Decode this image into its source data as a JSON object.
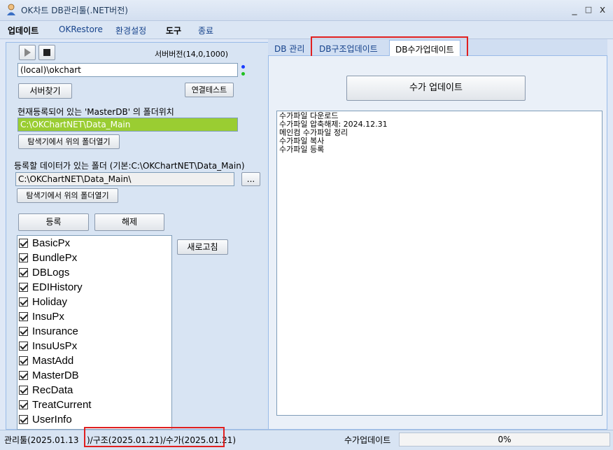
{
  "window": {
    "title": "OK차트 DB관리툴(.NET버전)",
    "minimize": "_",
    "maximize": "□",
    "close": "x"
  },
  "menu": [
    "업데이트",
    "OKRestore",
    "환경설정",
    "도구",
    "종료"
  ],
  "left": {
    "server_version": "서버버전(14,0,1000)",
    "server_value": "(local)\\okchart",
    "find_server_button": "서버찾기",
    "connect_test_button": "연결테스트",
    "masterdb_folder_label": "현재등록되어 있는 'MasterDB' 의 폴더위치",
    "masterdb_folder_value": "C:\\OKChartNET\\Data_Main",
    "open_folder_button_1": "탐색기에서 위의 폴더열기",
    "data_folder_label": "등록할 데이터가 있는 폴더 (기본:C:\\OKChartNET\\Data_Main)",
    "data_folder_value": "C:\\OKChartNET\\Data_Main\\",
    "browse_button": "...",
    "open_folder_button_2": "탐색기에서 위의 폴더열기",
    "register_button": "등록",
    "unregister_button": "해제",
    "refresh_button": "새로고침",
    "databases": [
      "BasicPx",
      "BundlePx",
      "DBLogs",
      "EDIHistory",
      "Holiday",
      "InsuPx",
      "Insurance",
      "InsuUsPx",
      "MastAdd",
      "MasterDB",
      "RecData",
      "TreatCurrent",
      "UserInfo"
    ]
  },
  "tabs": [
    "DB 관리",
    "DB구조업데이트",
    "DB수가업데이트"
  ],
  "right": {
    "update_button": "수가 업데이트",
    "log": [
      "수가파일 다운로드",
      "수가파일 압축해제: 2024.12.31",
      "메인컴 수가파일 정리",
      "수가파일 복사",
      "수가파일 등록"
    ]
  },
  "status": {
    "version_prefix": "관리툴(2025.01.13",
    "version_highlight": ")/구조(2025.01.21)/수가(2025.01.21)",
    "task": "수가업데이트",
    "progress": "0%"
  },
  "colors": {
    "highlight_field": "#9acd32",
    "annotation_red": "#e02020"
  }
}
